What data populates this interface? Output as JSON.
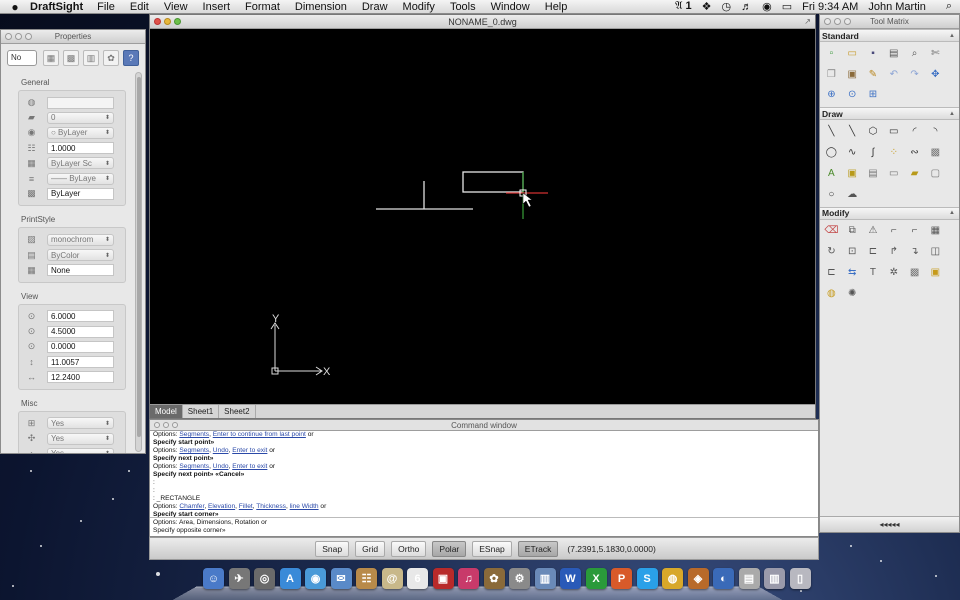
{
  "menubar": {
    "apple": "",
    "app_name": "DraftSight",
    "items": [
      "File",
      "Edit",
      "View",
      "Insert",
      "Format",
      "Dimension",
      "Draw",
      "Modify",
      "Tools",
      "Window",
      "Help"
    ],
    "status_input": "1",
    "clock": "Fri 9:34 AM",
    "user": "John Martin"
  },
  "properties": {
    "title": "Properties",
    "selection": "No",
    "sections": {
      "general": {
        "title": "General",
        "rows": [
          {
            "icon": "color-icon",
            "value": "",
            "type": "empty"
          },
          {
            "icon": "layer-icon",
            "value": "0",
            "type": "dropdown"
          },
          {
            "icon": "linestyle-icon",
            "value": "○ ByLayer",
            "type": "dropdown"
          },
          {
            "icon": "linescale-icon",
            "value": "1.0000",
            "type": "text"
          },
          {
            "icon": "lineweight-icon",
            "value": "ByLayer   Sc",
            "type": "dropdown"
          },
          {
            "icon": "line-icon",
            "value": "—— ByLaye",
            "type": "dropdown"
          },
          {
            "icon": "transparency-icon",
            "value": "ByLayer",
            "type": "text"
          }
        ]
      },
      "printstyle": {
        "title": "PrintStyle",
        "rows": [
          {
            "icon": "print-icon",
            "value": "monochrom",
            "type": "dropdown"
          },
          {
            "icon": "printcolor-icon",
            "value": "ByColor",
            "type": "dropdown"
          },
          {
            "icon": "table-icon",
            "value": "None",
            "type": "text"
          }
        ]
      },
      "view": {
        "title": "View",
        "rows": [
          {
            "icon": "zoom-icon",
            "value": "6.0000",
            "type": "text"
          },
          {
            "icon": "zoom-icon",
            "value": "4.5000",
            "type": "text"
          },
          {
            "icon": "zoom-icon",
            "value": "0.0000",
            "type": "text"
          },
          {
            "icon": "height-icon",
            "value": "11.0057",
            "type": "text"
          },
          {
            "icon": "width-icon",
            "value": "12.2400",
            "type": "text"
          }
        ]
      },
      "misc": {
        "title": "Misc",
        "rows": [
          {
            "icon": "ucs-icon",
            "value": "Yes",
            "type": "dropdown"
          },
          {
            "icon": "origin-icon",
            "value": "Yes",
            "type": "dropdown"
          },
          {
            "icon": "misc-icon",
            "value": "Yes",
            "type": "dropdown"
          }
        ]
      }
    }
  },
  "drawing": {
    "title": "NONAME_0.dwg",
    "tabs": [
      "Model",
      "Sheet1",
      "Sheet2"
    ],
    "active_tab": "Model",
    "axis_y": "Y",
    "axis_x": "X"
  },
  "command": {
    "title": "Command window",
    "log": [
      [
        {
          "t": "Options: "
        },
        {
          "t": "Segments",
          "c": "blue"
        },
        {
          "t": ", "
        },
        {
          "t": "Enter to continue from last point",
          "c": "blue"
        },
        {
          "t": " or"
        }
      ],
      [
        {
          "t": "Specify start point»",
          "c": "b"
        }
      ],
      [
        {
          "t": "Options: "
        },
        {
          "t": "Segments",
          "c": "blue"
        },
        {
          "t": ", "
        },
        {
          "t": "Undo",
          "c": "blue"
        },
        {
          "t": ", "
        },
        {
          "t": "Enter to exit",
          "c": "blue"
        },
        {
          "t": " or"
        }
      ],
      [
        {
          "t": "Specify next point»",
          "c": "b"
        }
      ],
      [
        {
          "t": "Options: "
        },
        {
          "t": "Segments",
          "c": "blue"
        },
        {
          "t": ", "
        },
        {
          "t": "Undo",
          "c": "blue"
        },
        {
          "t": ", "
        },
        {
          "t": "Enter to exit",
          "c": "blue"
        },
        {
          "t": " or"
        }
      ],
      [
        {
          "t": "Specify next point» «Cancel»",
          "c": "b"
        }
      ],
      [
        {
          "t": ":"
        }
      ],
      [
        {
          "t": ":"
        }
      ],
      [
        {
          "t": ": _RECTANGLE"
        }
      ],
      [
        {
          "t": "Options: "
        },
        {
          "t": "Chamfer",
          "c": "blue"
        },
        {
          "t": ", "
        },
        {
          "t": "Elevation",
          "c": "blue"
        },
        {
          "t": ", "
        },
        {
          "t": "Fillet",
          "c": "blue"
        },
        {
          "t": ", "
        },
        {
          "t": "Thickness",
          "c": "blue"
        },
        {
          "t": ", "
        },
        {
          "t": "line Width",
          "c": "blue"
        },
        {
          "t": " or"
        }
      ],
      [
        {
          "t": "Specify start corner»",
          "c": "b"
        }
      ]
    ],
    "prompt": [
      [
        {
          "t": "Options: "
        },
        {
          "t": "Area",
          "c": "blue"
        },
        {
          "t": ", "
        },
        {
          "t": "Dimensions",
          "c": "blue"
        },
        {
          "t": ", "
        },
        {
          "t": "Rotation",
          "c": "blue"
        },
        {
          "t": " or"
        }
      ],
      [
        {
          "t": "Specify opposite corner»",
          "c": "b"
        }
      ]
    ]
  },
  "statusbar": {
    "buttons": [
      {
        "label": "Snap",
        "on": false
      },
      {
        "label": "Grid",
        "on": false
      },
      {
        "label": "Ortho",
        "on": false
      },
      {
        "label": "Polar",
        "on": true
      },
      {
        "label": "ESnap",
        "on": false
      },
      {
        "label": "ETrack",
        "on": true
      }
    ],
    "coordinates": "(7.2391,5.1830,0.0000)"
  },
  "toolmatrix": {
    "title": "Tool Matrix",
    "sections": [
      {
        "title": "Standard",
        "tools": [
          {
            "name": "new-icon",
            "glyph": "▫",
            "color": "#3a9a3a"
          },
          {
            "name": "open-icon",
            "glyph": "▭",
            "color": "#c79a2a"
          },
          {
            "name": "save-icon",
            "glyph": "▪",
            "color": "#4a4a7a"
          },
          {
            "name": "print-icon",
            "glyph": "▤",
            "color": "#555555"
          },
          {
            "name": "print-preview-icon",
            "glyph": "⌕",
            "color": "#555555"
          },
          {
            "name": "properties-icon",
            "glyph": "✄",
            "color": "#666666"
          },
          {
            "name": "copy-icon",
            "glyph": "❐",
            "color": "#888888"
          },
          {
            "name": "paste-icon",
            "glyph": "▣",
            "color": "#8a6a3a"
          },
          {
            "name": "match-properties-icon",
            "glyph": "✎",
            "color": "#b8861e"
          },
          {
            "name": "undo-icon",
            "glyph": "↶",
            "color": "#8aa3d4"
          },
          {
            "name": "redo-icon",
            "glyph": "↷",
            "color": "#8aa3d4"
          },
          {
            "name": "pan-icon",
            "glyph": "✥",
            "color": "#3a6fc4"
          },
          {
            "name": "zoom-window-icon",
            "glyph": "⊕",
            "color": "#3a6fc4"
          },
          {
            "name": "zoom-realtime-icon",
            "glyph": "⊙",
            "color": "#3a6fc4"
          },
          {
            "name": "zoom-fit-icon",
            "glyph": "⊞",
            "color": "#3a6fc4"
          }
        ]
      },
      {
        "title": "Draw",
        "tools": [
          {
            "name": "line-icon",
            "glyph": "╲",
            "color": "#333333"
          },
          {
            "name": "infinite-line-icon",
            "glyph": "╲",
            "color": "#333333"
          },
          {
            "name": "polygon-icon",
            "glyph": "⬡",
            "color": "#333333"
          },
          {
            "name": "rectangle-icon",
            "glyph": "▭",
            "color": "#333333"
          },
          {
            "name": "arc-icon",
            "glyph": "◜",
            "color": "#333333"
          },
          {
            "name": "arc2-icon",
            "glyph": "◝",
            "color": "#333333"
          },
          {
            "name": "circle-icon",
            "glyph": "◯",
            "color": "#333333"
          },
          {
            "name": "polyline-icon",
            "glyph": "∿",
            "color": "#333333"
          },
          {
            "name": "spline-icon",
            "glyph": "∫",
            "color": "#333333"
          },
          {
            "name": "point-icon",
            "glyph": "⁘",
            "color": "#c69a1a"
          },
          {
            "name": "spline2-icon",
            "glyph": "∾",
            "color": "#333333"
          },
          {
            "name": "hatch-icon",
            "glyph": "▩",
            "color": "#777777"
          },
          {
            "name": "text-icon",
            "glyph": "A",
            "color": "#4a8a2a"
          },
          {
            "name": "block-icon",
            "glyph": "▣",
            "color": "#b89a1a"
          },
          {
            "name": "table-icon",
            "glyph": "▤",
            "color": "#777777"
          },
          {
            "name": "image-icon",
            "glyph": "▭",
            "color": "#777777"
          },
          {
            "name": "note-icon",
            "glyph": "▰",
            "color": "#b89a1a"
          },
          {
            "name": "region-icon",
            "glyph": "▢",
            "color": "#777777"
          },
          {
            "name": "ellipse-icon",
            "glyph": "○",
            "color": "#333333"
          },
          {
            "name": "cloud-icon",
            "glyph": "☁",
            "color": "#555555"
          }
        ]
      },
      {
        "title": "Modify",
        "tools": [
          {
            "name": "erase-icon",
            "glyph": "⌫",
            "color": "#c44a4a"
          },
          {
            "name": "copy-entity-icon",
            "glyph": "⧉",
            "color": "#555555"
          },
          {
            "name": "mirror-icon",
            "glyph": "⚠",
            "color": "#555555"
          },
          {
            "name": "offset-icon",
            "glyph": "⌐",
            "color": "#555555"
          },
          {
            "name": "fillet-icon",
            "glyph": "⌐",
            "color": "#555555"
          },
          {
            "name": "pattern-icon",
            "glyph": "▦",
            "color": "#555555"
          },
          {
            "name": "rotate-icon",
            "glyph": "↻",
            "color": "#555555"
          },
          {
            "name": "scale-icon",
            "glyph": "⊡",
            "color": "#555555"
          },
          {
            "name": "stretch-icon",
            "glyph": "⊏",
            "color": "#555555"
          },
          {
            "name": "trim-icon",
            "glyph": "↱",
            "color": "#555555"
          },
          {
            "name": "extend-icon",
            "glyph": "↴",
            "color": "#555555"
          },
          {
            "name": "chamfer-icon",
            "glyph": "◫",
            "color": "#555555"
          },
          {
            "name": "break-icon",
            "glyph": "⊏",
            "color": "#555555"
          },
          {
            "name": "join-icon",
            "glyph": "⇆",
            "color": "#3a6fc4"
          },
          {
            "name": "text-edit-icon",
            "glyph": "T",
            "color": "#555555"
          },
          {
            "name": "explode-icon",
            "glyph": "✲",
            "color": "#555555"
          },
          {
            "name": "hatch-edit-icon",
            "glyph": "▩",
            "color": "#777777"
          },
          {
            "name": "group-icon",
            "glyph": "▣",
            "color": "#c69a1a"
          },
          {
            "name": "properties-paint-icon",
            "glyph": "◍",
            "color": "#c69a1a"
          },
          {
            "name": "flame-icon",
            "glyph": "✺",
            "color": "#555555"
          }
        ]
      }
    ],
    "footer": "◂◂◂◂◂"
  },
  "dock": [
    {
      "name": "finder-icon",
      "glyph": "☺",
      "color": "#4a7ac8"
    },
    {
      "name": "launchpad-icon",
      "glyph": "✈",
      "color": "#777777"
    },
    {
      "name": "dashboard-icon",
      "glyph": "◎",
      "color": "#6a6a6a"
    },
    {
      "name": "app-store-icon",
      "glyph": "A",
      "color": "#3a8ad8"
    },
    {
      "name": "safari-icon",
      "glyph": "◉",
      "color": "#4a9ad8"
    },
    {
      "name": "mail-icon",
      "glyph": "✉",
      "color": "#5a8ac8"
    },
    {
      "name": "contacts-icon",
      "glyph": "☷",
      "color": "#b88a4a"
    },
    {
      "name": "address-icon",
      "glyph": "@",
      "color": "#c8b88a"
    },
    {
      "name": "calendar-icon",
      "glyph": "6",
      "color": "#e8e8e8"
    },
    {
      "name": "photobooth-icon",
      "glyph": "▣",
      "color": "#b82a2a"
    },
    {
      "name": "itunes-icon",
      "glyph": "♫",
      "color": "#c83a6a"
    },
    {
      "name": "iphoto-icon",
      "glyph": "✿",
      "color": "#8a6a3a"
    },
    {
      "name": "system-preferences-icon",
      "glyph": "⚙",
      "color": "#8a8a8a"
    },
    {
      "name": "preview-icon",
      "glyph": "▥",
      "color": "#6a8ab8"
    },
    {
      "name": "word-icon",
      "glyph": "W",
      "color": "#2a5ab8"
    },
    {
      "name": "excel-icon",
      "glyph": "X",
      "color": "#2a9a3a"
    },
    {
      "name": "powerpoint-icon",
      "glyph": "P",
      "color": "#d85a2a"
    },
    {
      "name": "skype-icon",
      "glyph": "S",
      "color": "#2aa0e8"
    },
    {
      "name": "chrome-icon",
      "glyph": "◍",
      "color": "#d8a82a"
    },
    {
      "name": "draftsight-icon",
      "glyph": "◈",
      "color": "#b86a2a"
    },
    {
      "name": "quicktime-icon",
      "glyph": "◐",
      "color": "#3a6ab8"
    },
    {
      "name": "documents-icon",
      "glyph": "▤",
      "color": "#aaaaaa"
    },
    {
      "name": "downloads-icon",
      "glyph": "▥",
      "color": "#9a9aaa"
    },
    {
      "name": "trash-icon",
      "glyph": "▯",
      "color": "#b8b8c0"
    }
  ],
  "colors": {
    "canvas": "#000000",
    "crosshair_x": "#d03030",
    "crosshair_y": "#3aa03a",
    "entities": "#ffffff"
  }
}
